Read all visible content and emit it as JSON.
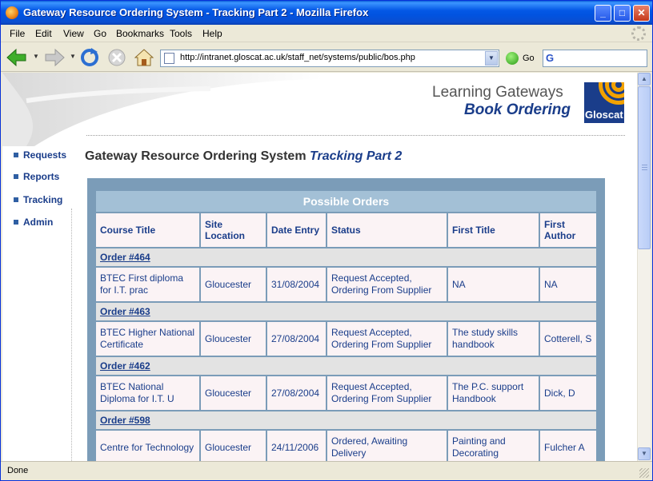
{
  "window": {
    "title": "Gateway Resource Ordering System - Tracking Part 2 - Mozilla Firefox",
    "minimize": "_",
    "maximize": "□",
    "close": "✕"
  },
  "menu": [
    "File",
    "Edit",
    "View",
    "Go",
    "Bookmarks",
    "Tools",
    "Help"
  ],
  "nav": {
    "url": "http://intranet.gloscat.ac.uk/staff_net/systems/public/bos.php",
    "go_label": "Go",
    "search_placeholder": ""
  },
  "status": "Done",
  "brand": {
    "line1": "Learning Gateways",
    "line2": "Book Ordering",
    "logo_text": "Gloscat"
  },
  "sidebar": [
    "Requests",
    "Reports",
    "Tracking",
    "Admin"
  ],
  "heading": {
    "main": "Gateway Resource Ordering System",
    "accent": "Tracking Part 2"
  },
  "table": {
    "caption": "Possible Orders",
    "columns": [
      "Course Title",
      "Site Location",
      "Date Entry",
      "Status",
      "First Title",
      "First Author"
    ],
    "orders": [
      {
        "order": "Order #464",
        "course": "BTEC First diploma for I.T. prac",
        "site": "Gloucester",
        "date": "31/08/2004",
        "status": "Request Accepted, Ordering From Supplier",
        "first_title": "NA",
        "first_author": "NA"
      },
      {
        "order": "Order #463",
        "course": "BTEC Higher National Certificate",
        "site": "Gloucester",
        "date": "27/08/2004",
        "status": "Request Accepted, Ordering From Supplier",
        "first_title": "The study skills handbook",
        "first_author": "Cotterell, S"
      },
      {
        "order": "Order #462",
        "course": "BTEC National Diploma for I.T. U",
        "site": "Gloucester",
        "date": "27/08/2004",
        "status": "Request Accepted, Ordering From Supplier",
        "first_title": "The P.C. support Handbook",
        "first_author": "Dick, D"
      },
      {
        "order": "Order #598",
        "course": "Centre for Technology",
        "site": "Gloucester",
        "date": "24/11/2006",
        "status": "Ordered, Awaiting Delivery",
        "first_title": "Painting and Decorating",
        "first_author": "Fulcher A"
      }
    ]
  },
  "colors": {
    "titlebar": "#0458e6",
    "accent_blue": "#1a3d8a",
    "panel": "#7b9cb8",
    "caption": "#a3c0d6",
    "logo_orange": "#f2a200"
  }
}
